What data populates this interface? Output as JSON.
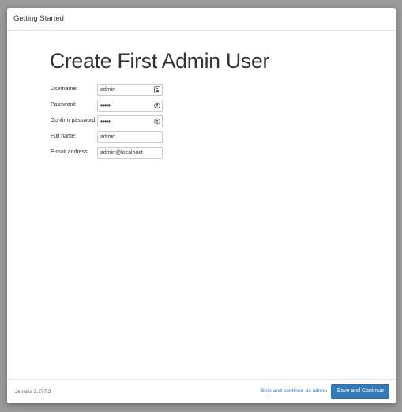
{
  "window": {
    "title": "Getting Started"
  },
  "main": {
    "title": "Create First Admin User"
  },
  "form": {
    "fields": [
      {
        "label": "Username:",
        "value": "admin",
        "type": "text",
        "icon": "contact-card-icon"
      },
      {
        "label": "Password:",
        "value": "•••••",
        "type": "password",
        "icon": "key-icon"
      },
      {
        "label": "Confirm password:",
        "value": "•••••",
        "type": "password",
        "icon": "key-icon"
      },
      {
        "label": "Full name:",
        "value": "admin",
        "type": "text",
        "icon": ""
      },
      {
        "label": "E-mail address:",
        "value": "admin@localhost",
        "type": "text",
        "icon": ""
      }
    ]
  },
  "footer": {
    "version": "Jenkins 2.277.3",
    "skip_label": "Skip and continue as admin",
    "save_label": "Save and Continue"
  },
  "colors": {
    "primary": "#337ab7",
    "link": "#337ab7",
    "backdrop": "#9a9a9a"
  }
}
